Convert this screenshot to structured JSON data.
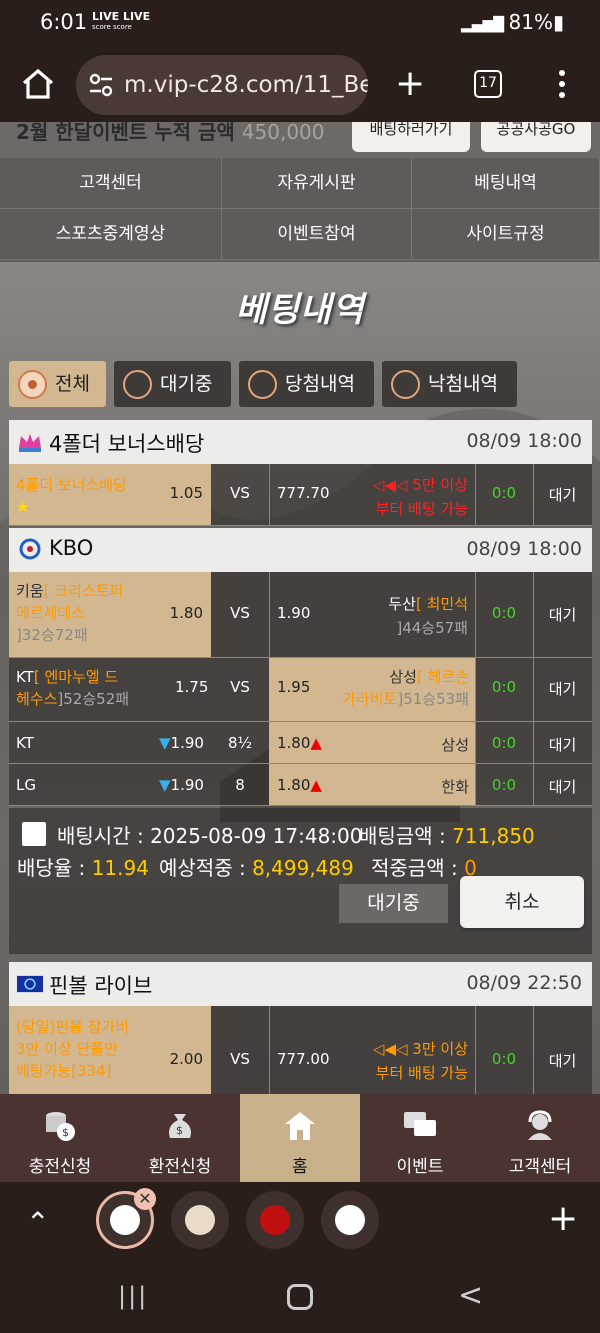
{
  "status": {
    "time": "6:01",
    "live1": "LIVE LIVE",
    "live2": "score score",
    "battery": "81%"
  },
  "browser": {
    "url": "m.vip-c28.com/11_Be",
    "tab_count": "17"
  },
  "topstrip": {
    "text": "2월  한달이벤트  누적  금액",
    "amount": "450,000",
    "btn1": "배팅하러가기",
    "btn2": "공공사공GO"
  },
  "nav": [
    "고객센터",
    "자유게시판",
    "베팅내역",
    "스포츠중계영상",
    "이벤트참여",
    "사이트규정"
  ],
  "page_title": "베팅내역",
  "filters": [
    "전체",
    "대기중",
    "당첨내역",
    "낙첨내역"
  ],
  "bets": [
    {
      "league": "4폴더 보너스배당",
      "datetime": "08/09 18:00",
      "rows": [
        {
          "home": "4폴더 보너스배당",
          "star": "★",
          "home_odd": "1.05",
          "mid": "VS",
          "away_odd": "777.70",
          "note1": "◁◀◁ 5만 이상",
          "note2": "부터 배팅 가능",
          "score": "0:0",
          "status": "대기"
        }
      ]
    },
    {
      "league": "KBO",
      "datetime": "08/09 18:00",
      "rows": [
        {
          "home_team": "키움",
          "home_pitcher1": "[ 크리스토퍼",
          "home_pitcher2": "메르세데스",
          "home_rec": "]32승72패",
          "home_odd": "1.80",
          "mid": "VS",
          "away_odd": "1.90",
          "away_team": "두산",
          "away_pitcher": "[ 최민석",
          "away_rec": "]44승57패",
          "score": "0:0",
          "status": "대기"
        },
        {
          "home_team": "KT",
          "home_pitcher1": "[ 엔마누엘 드",
          "home_pitcher2": "헤수스",
          "home_rec": "]52승52패",
          "home_odd": "1.75",
          "mid": "VS",
          "away_odd": "1.95",
          "away_team": "삼성",
          "away_pitcher": "[ 헤르손",
          "away_pitcher2": "가라비토",
          "away_rec": "]51승53패",
          "score": "0:0",
          "status": "대기"
        },
        {
          "home_team": "KT",
          "home_odd": "1.90",
          "mid": "8½",
          "away_odd": "1.80",
          "away_team": "삼성",
          "score": "0:0",
          "status": "대기"
        },
        {
          "home_team": "LG",
          "home_odd": "1.90",
          "mid": "8",
          "away_odd": "1.80",
          "away_team": "한화",
          "score": "0:0",
          "status": "대기"
        }
      ],
      "summary": {
        "bet_time_label": "배팅시간 :",
        "bet_time": "2025-08-09 17:48:00",
        "bet_amount_label": "배팅금액 :",
        "bet_amount": "711,850",
        "odds_label": "배당율 :",
        "odds": "11.94",
        "expected_label": "예상적중 :",
        "expected": "8,499,489",
        "win_label": "적중금액 :",
        "win": "0",
        "status_btn": "대기중",
        "cancel_btn": "취소"
      }
    },
    {
      "league": "핀볼 라이브",
      "datetime": "08/09 22:50",
      "rows": [
        {
          "home1": "(당일)핀볼 참가비",
          "home2": "3만 이상 단폴만",
          "home3": "배팅가능[334]",
          "home_odd": "2.00",
          "mid": "VS",
          "away_odd": "777.00",
          "note1": "◁◀◁ 3만 이상",
          "note2": "부터 배팅 가능",
          "score": "0:0",
          "status": "대기"
        }
      ]
    }
  ],
  "bottom_nav": [
    "충전신청",
    "환전신청",
    "홈",
    "이벤트",
    "고객센터"
  ],
  "icons": {
    "home": "home-icon",
    "tune": "site-settings-icon",
    "plus": "plus-icon",
    "menu": "more-vert-icon"
  },
  "colors": {
    "accent": "#d2b790",
    "orange": "#ff9a00",
    "green": "#46d42a",
    "yellow": "#ffcc00"
  }
}
